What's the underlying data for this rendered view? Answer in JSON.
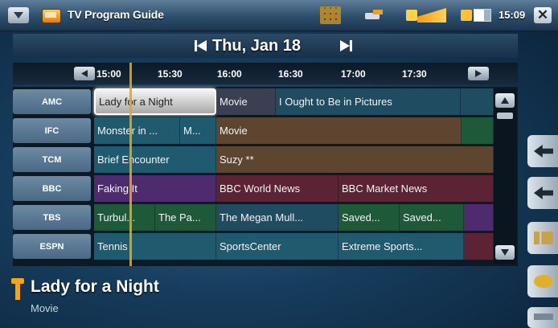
{
  "header": {
    "title": "TV Program Guide",
    "clock": "15:09",
    "close": "✕"
  },
  "date_nav": {
    "date": "Thu, Jan 18"
  },
  "timeline": {
    "times": [
      "15:00",
      "15:30",
      "16:00",
      "16:30",
      "17:00",
      "17:30"
    ]
  },
  "guide": {
    "channels": [
      {
        "name": "AMC",
        "programs": [
          {
            "title": "Lady for a Night",
            "selected": true
          },
          {
            "title": "Movie"
          },
          {
            "title": "I Ought to Be in Pictures"
          },
          {
            "title": ""
          }
        ]
      },
      {
        "name": "IFC",
        "programs": [
          {
            "title": "Monster in ..."
          },
          {
            "title": "M..."
          },
          {
            "title": "Movie"
          },
          {
            "title": ""
          }
        ]
      },
      {
        "name": "TCM",
        "programs": [
          {
            "title": "Brief Encounter"
          },
          {
            "title": "Suzy **"
          }
        ]
      },
      {
        "name": "BBC",
        "programs": [
          {
            "title": "Faking It"
          },
          {
            "title": "BBC World News"
          },
          {
            "title": "BBC Market News"
          }
        ]
      },
      {
        "name": "TBS",
        "programs": [
          {
            "title": "Turbul..."
          },
          {
            "title": "The Pa..."
          },
          {
            "title": "The Megan Mull..."
          },
          {
            "title": "Saved..."
          },
          {
            "title": "Saved..."
          },
          {
            "title": ""
          }
        ]
      },
      {
        "name": "ESPN",
        "programs": [
          {
            "title": "Tennis"
          },
          {
            "title": "SportsCenter"
          },
          {
            "title": "Extreme Sports..."
          },
          {
            "title": ""
          }
        ]
      }
    ]
  },
  "info": {
    "title": "Lady for a Night",
    "subtitle": "Movie"
  },
  "colors": {
    "accent": "#e6a51a",
    "teal": "#1f5a6e",
    "brown": "#5e4530",
    "purple": "#4e2a6e",
    "maroon": "#5c2335",
    "green": "#1e5a3a"
  }
}
